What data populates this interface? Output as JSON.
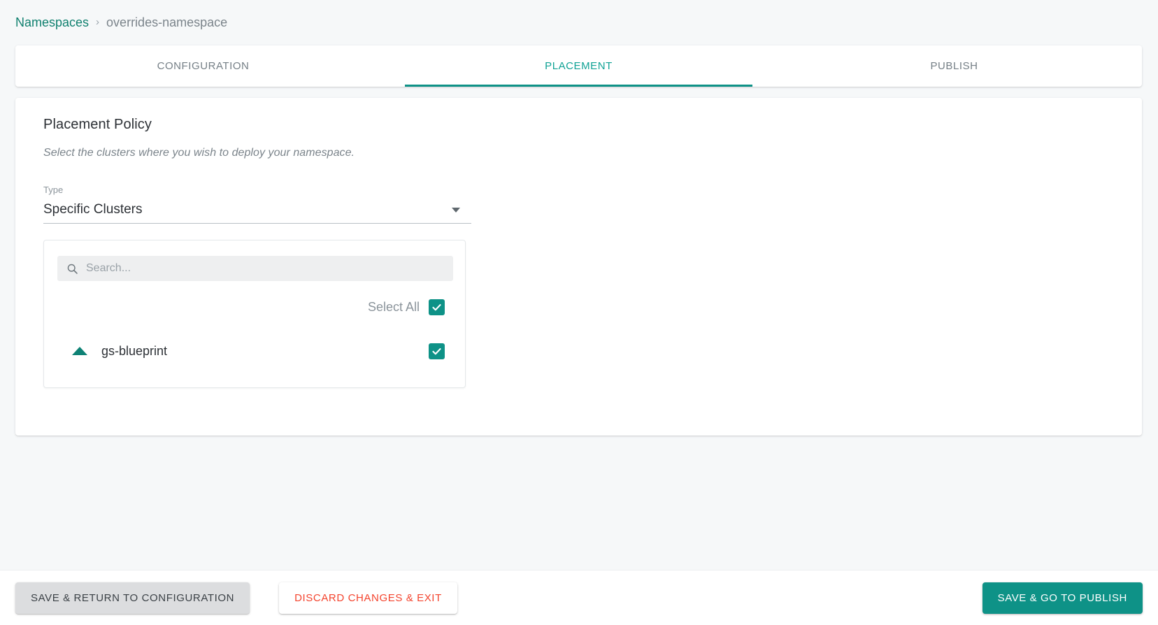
{
  "breadcrumb": {
    "root_label": "Namespaces",
    "separator": "›",
    "current_label": "overrides-namespace"
  },
  "tabs": [
    {
      "label": "CONFIGURATION",
      "active": false
    },
    {
      "label": "PLACEMENT",
      "active": true
    },
    {
      "label": "PUBLISH",
      "active": false
    }
  ],
  "main": {
    "title": "Placement Policy",
    "subtitle": "Select the clusters where you wish to deploy your namespace.",
    "type_field": {
      "label": "Type",
      "value": "Specific Clusters",
      "arrow_icon": "chevron-down-icon"
    },
    "cluster_panel": {
      "search": {
        "icon": "search-icon",
        "placeholder": "Search...",
        "value": ""
      },
      "select_all": {
        "label": "Select All",
        "checked": true
      },
      "clusters": [
        {
          "name": "gs-blueprint",
          "checked": true,
          "caret_icon": "caret-up-icon",
          "expanded": true
        }
      ]
    }
  },
  "footer": {
    "save_return_label": "SAVE & RETURN TO CONFIGURATION",
    "discard_label": "DISCARD CHANGES & EXIT",
    "save_publish_label": "SAVE & GO TO PUBLISH"
  },
  "colors": {
    "accent_teal": "#0e9287",
    "tab_active": "#10a295",
    "link_teal": "#10806f",
    "danger_red": "#f4442e",
    "page_bg": "#f6f8f9",
    "muted_text": "#7b848b"
  }
}
